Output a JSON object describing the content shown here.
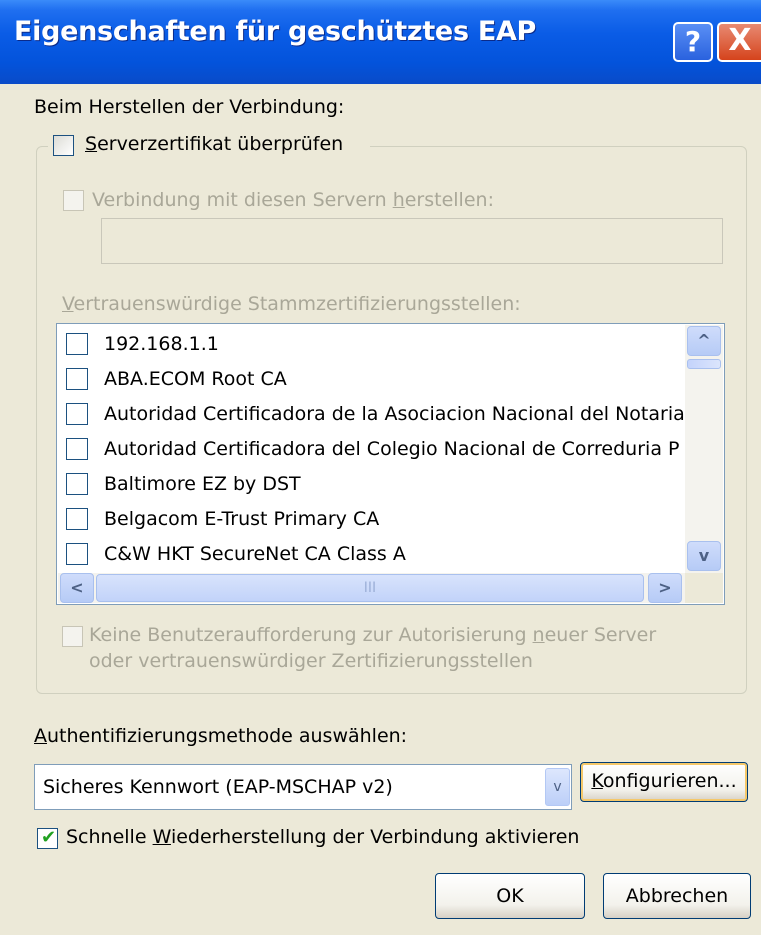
{
  "window": {
    "title": "Eigenschaften für geschütztes EAP",
    "help_glyph": "?",
    "close_glyph": "X"
  },
  "connection_label": "Beim Herstellen der Verbindung:",
  "verify_cert": {
    "prefix": "",
    "mnemonic": "S",
    "rest": "erverzertifikat überprüfen",
    "checked": false
  },
  "connect_servers": {
    "prefix": "Verbindung mit diesen Servern ",
    "mnemonic": "h",
    "rest": "erstellen:",
    "checked": false,
    "enabled": false,
    "value": ""
  },
  "trusted_roots": {
    "prefix": "",
    "mnemonic": "V",
    "rest": "ertrauenswürdige Stammzertifizierungsstellen:",
    "items": [
      "192.168.1.1",
      "ABA.ECOM Root CA",
      "Autoridad Certificadora de la Asociacion Nacional del Notaria",
      "Autoridad Certificadora del Colegio Nacional de Correduria P",
      "Baltimore EZ by DST",
      "Belgacom E-Trust Primary CA",
      "C&W HKT SecureNet CA Class A"
    ],
    "scroll_up": "^",
    "scroll_down": "v",
    "scroll_left": "<",
    "scroll_right": ">",
    "thumb_grip": "III"
  },
  "no_prompt": {
    "line1_prefix": "Keine Benutzeraufforderung zur Autorisierung ",
    "line1_mnemonic": "n",
    "line1_rest": "euer Server",
    "line2": "oder vertrauenswürdiger Zertifizierungsstellen",
    "checked": false,
    "enabled": false
  },
  "auth_method": {
    "label_mnemonic": "A",
    "label_rest": "uthentifizierungsmethode auswählen:",
    "selected": "Sicheres Kennwort (EAP-MSCHAP v2)",
    "configure_mnemonic": "K",
    "configure_rest": "onfigurieren..."
  },
  "fast_reconnect": {
    "prefix": "Schnelle ",
    "mnemonic": "W",
    "rest": "iederherstellung der Verbindung aktivieren",
    "checked": true
  },
  "buttons": {
    "ok": "OK",
    "cancel": "Abbrechen"
  },
  "colors": {
    "titlebar": "#0a5ce6",
    "dialog_bg": "#ece9d8",
    "disabled_text": "#a9a798",
    "checkmark": "#21a121"
  }
}
